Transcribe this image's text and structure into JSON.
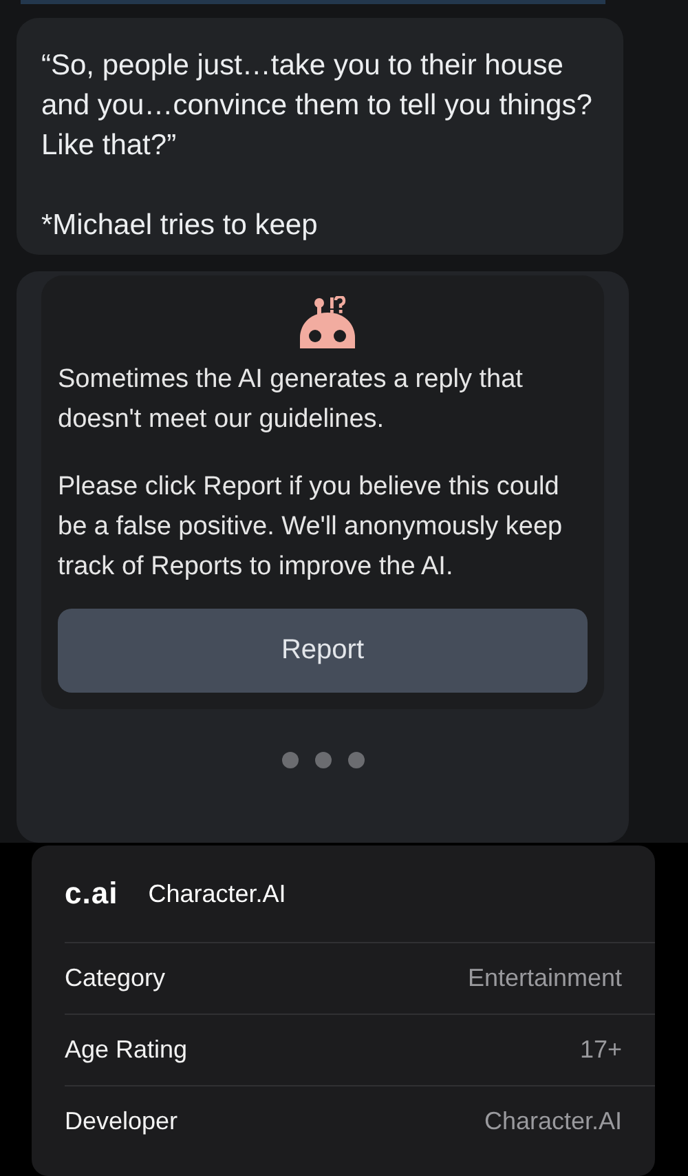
{
  "chat": {
    "message": "“So, people just…take you to their house and you…convince them to tell you things? Like that?”\n\n*Michael tries to keep",
    "filter_notice": {
      "text_1": "Sometimes the AI generates a reply that doesn't meet our guidelines.",
      "text_2": "Please click Report if you believe this could be a false positive. We'll anonymously keep track of Reports to improve the AI.",
      "button": "Report"
    },
    "dots": [
      {
        "selected": false
      },
      {
        "selected": false
      },
      {
        "selected": false
      }
    ]
  },
  "app_info": {
    "logo": "c.ai",
    "name": "Character.AI",
    "rows": [
      {
        "label": "Category",
        "value": "Entertainment"
      },
      {
        "label": "Age Rating",
        "value": "17+"
      },
      {
        "label": "Developer",
        "value": "Character.AI"
      }
    ]
  }
}
